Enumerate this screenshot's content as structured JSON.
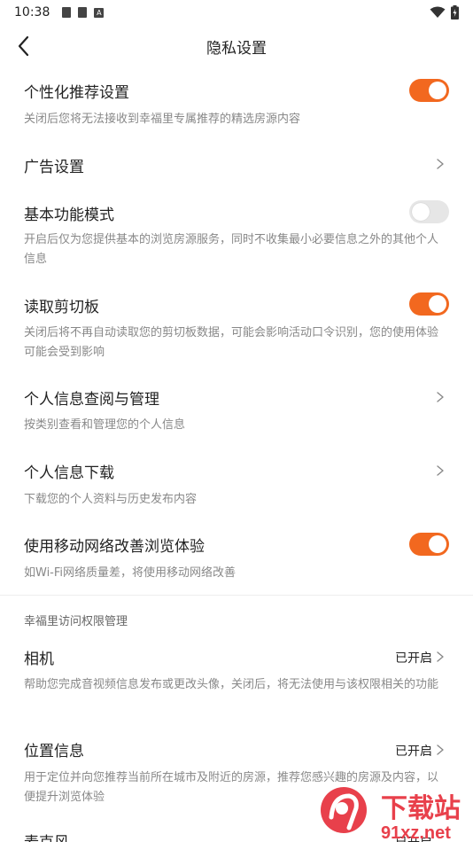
{
  "status_bar": {
    "time": "10:38",
    "a_icon": "A"
  },
  "nav": {
    "title": "隐私设置"
  },
  "settings": [
    {
      "title": "个性化推荐设置",
      "desc": "关闭后您将无法接收到幸福里专属推荐的精选房源内容",
      "control": "toggle",
      "on": true
    },
    {
      "title": "广告设置",
      "control": "chevron"
    },
    {
      "title": "基本功能模式",
      "desc": "开启后仅为您提供基本的浏览房源服务，同时不收集最小必要信息之外的其他个人信息",
      "control": "toggle",
      "on": false
    },
    {
      "title": "读取剪切板",
      "desc": "关闭后将不再自动读取您的剪切板数据，可能会影响活动口令识别，您的使用体验可能会受到影响",
      "control": "toggle",
      "on": true
    },
    {
      "title": "个人信息查阅与管理",
      "desc": "按类别查看和管理您的个人信息",
      "control": "chevron"
    },
    {
      "title": "个人信息下载",
      "desc": "下载您的个人资料与历史发布内容",
      "control": "chevron"
    },
    {
      "title": "使用移动网络改善浏览体验",
      "desc": "如Wi-Fi网络质量差，将使用移动网络改善",
      "control": "toggle",
      "on": true
    }
  ],
  "permissions": {
    "section_title": "幸福里访问权限管理",
    "items": [
      {
        "title": "相机",
        "status": "已开启",
        "desc": "帮助您完成音视频信息发布或更改头像，关闭后，将无法使用与该权限相关的功能"
      },
      {
        "title": "位置信息",
        "status": "已开启",
        "desc": "用于定位并向您推荐当前所在城市及附近的房源，推荐您感兴趣的房源及内容，以便提升浏览体验"
      },
      {
        "title": "麦克风",
        "status": "已开启"
      }
    ]
  },
  "watermark": {
    "logo_text": "下载站",
    "url_text": "91xz.net"
  },
  "colors": {
    "accent": "#f2681f",
    "toggle_off": "#e6e6e6",
    "desc_text": "#888888"
  }
}
